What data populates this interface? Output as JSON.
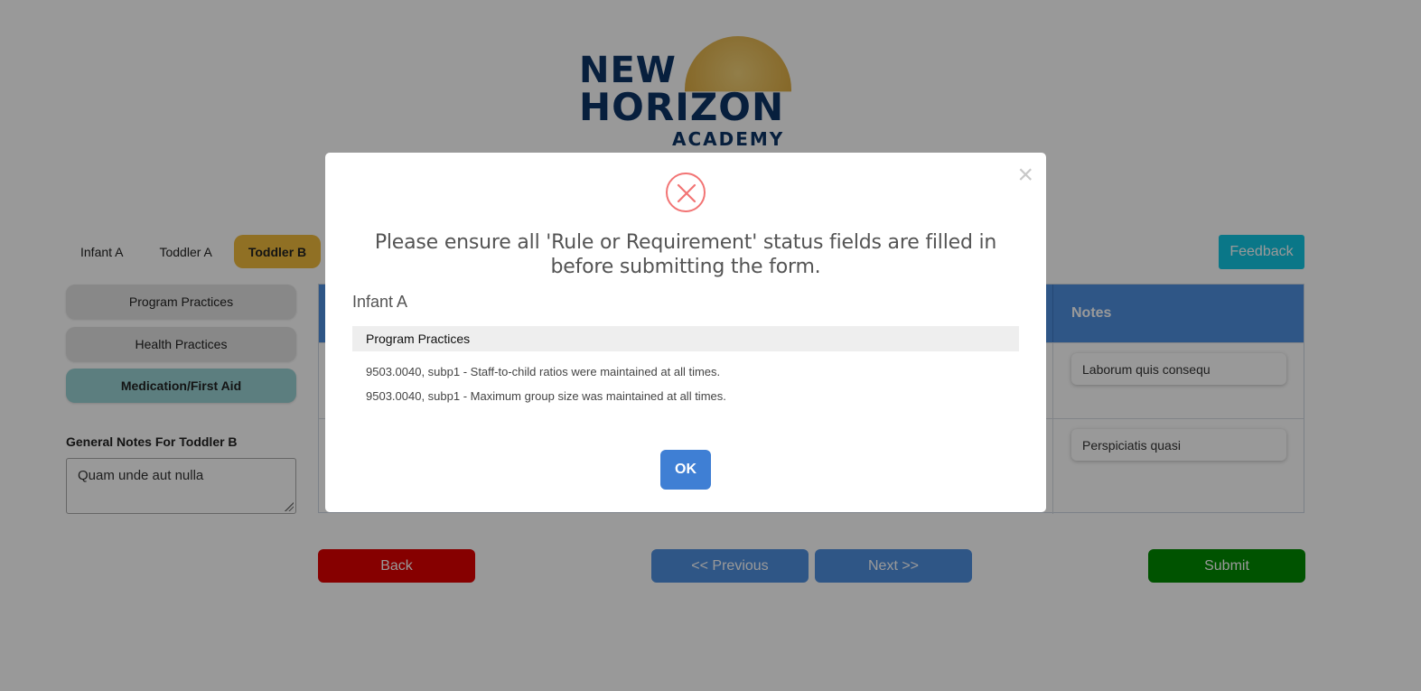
{
  "logo": {
    "line1": "NEW",
    "line2": "HORIZON",
    "line3": "ACADEMY",
    "sun_color": "#e2b24a",
    "text_color": "#0d3466"
  },
  "tabs": [
    {
      "label": "Infant A",
      "active": false
    },
    {
      "label": "Toddler A",
      "active": false
    },
    {
      "label": "Toddler B",
      "active": true
    }
  ],
  "feedback_label": "Feedback",
  "sidebar": {
    "items": [
      {
        "label": "Program Practices",
        "active": false
      },
      {
        "label": "Health Practices",
        "active": false
      },
      {
        "label": "Medication/First Aid",
        "active": true
      }
    ],
    "general_notes_label": "General Notes For Toddler B",
    "general_notes_value": "Quam unde aut nulla"
  },
  "table": {
    "notes_header": "Notes",
    "rows": [
      {
        "note": "Laborum quis consequ"
      },
      {
        "note": "Perspiciatis quasi"
      }
    ]
  },
  "buttons": {
    "back": "Back",
    "previous": "<< Previous",
    "next": "Next >>",
    "submit": "Submit"
  },
  "modal": {
    "icon": "error-x-icon",
    "close_glyph": "×",
    "title": "Please ensure all 'Rule or Requirement' status fields are filled in before submitting the form.",
    "section": "Infant A",
    "category": "Program Practices",
    "items": [
      "9503.0040, subp1 - Staff-to-child ratios were maintained at all times.",
      "9503.0040, subp1 - Maximum group size was maintained at all times."
    ],
    "ok_label": "OK"
  },
  "colors": {
    "accent_blue": "#4f8fe0",
    "active_tab": "#f0bb3c",
    "active_sidebar": "#9ad3d4",
    "feedback": "#12c6e3",
    "back": "#e00000",
    "submit": "#008a00",
    "error_icon": "#f27474",
    "ok_button": "#3f7fd4"
  }
}
